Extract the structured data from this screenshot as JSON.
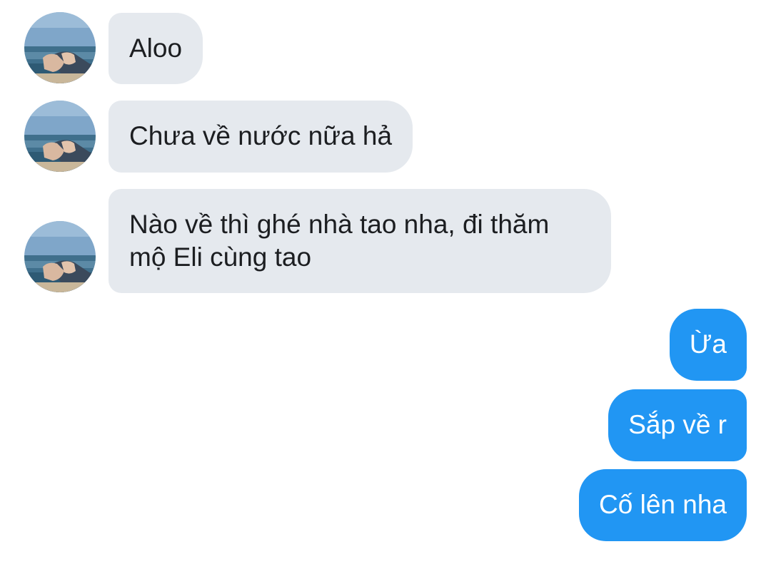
{
  "conversation": {
    "incoming_avatar": {
      "alt": "",
      "icon": "beach-photo-avatar"
    },
    "messages": [
      {
        "direction": "incoming",
        "text": "Aloo"
      },
      {
        "direction": "incoming",
        "text": "Chưa về nước nữa hả"
      },
      {
        "direction": "incoming",
        "text": "Nào về thì ghé nhà tao nha, đi thăm mộ Eli cùng tao"
      },
      {
        "direction": "outgoing",
        "text": "Ừa"
      },
      {
        "direction": "outgoing",
        "text": "Sắp về r"
      },
      {
        "direction": "outgoing",
        "text": "Cố lên nha"
      }
    ]
  },
  "colors": {
    "incoming_bubble": "#e5e9ee",
    "outgoing_bubble": "#2196f3",
    "incoming_text": "#1c1e21",
    "outgoing_text": "#ffffff"
  }
}
